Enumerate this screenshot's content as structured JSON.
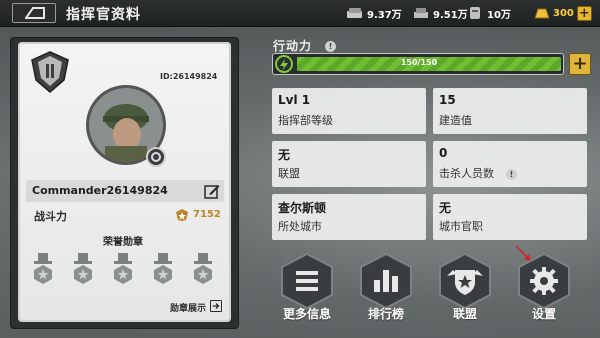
{
  "header": {
    "title": "指挥官资料",
    "resources": [
      {
        "icon": "food-icon",
        "value": "9.37万"
      },
      {
        "icon": "iron-icon",
        "value": "9.51万"
      },
      {
        "icon": "oil-icon",
        "value": "10万"
      }
    ],
    "gold": {
      "icon": "gold-icon",
      "value": "300",
      "plus": "+"
    }
  },
  "profile": {
    "uid": "ID:26149824",
    "name": "Commander26149824",
    "power_label": "战斗力",
    "power_value": "7152",
    "medals_title": "荣誉勋章",
    "medal_count": 5,
    "medal_show": "勋章展示"
  },
  "action_points": {
    "label": "行动力",
    "current": "150/150",
    "fill_fraction": 1.0,
    "plus": "+"
  },
  "stats": [
    {
      "value": "Lvl 1",
      "label": "指挥部等级"
    },
    {
      "value": "15",
      "label": "建造值"
    },
    {
      "value": "无",
      "label": "联盟"
    },
    {
      "value": "0",
      "label": "击杀人员数"
    },
    {
      "value": "查尔斯顿",
      "label": "所处城市"
    },
    {
      "value": "无",
      "label": "城市官职"
    }
  ],
  "actions": [
    {
      "label": "更多信息",
      "icon": "menu-icon"
    },
    {
      "label": "排行榜",
      "icon": "ranking-icon"
    },
    {
      "label": "联盟",
      "icon": "alliance-icon"
    },
    {
      "label": "设置",
      "icon": "settings-icon"
    }
  ],
  "colors": {
    "accent_gold": "#e0b63a",
    "bar_green": "#6fbe34",
    "power_gold": "#b8862a",
    "pointer_red": "#d42323"
  }
}
